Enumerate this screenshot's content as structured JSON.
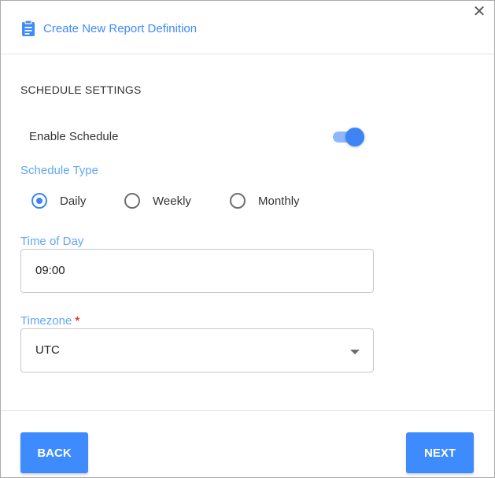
{
  "dialog": {
    "title": "Create New Report Definition",
    "header_icon": "clipboard-icon",
    "close_label": "✕"
  },
  "schedule": {
    "section_heading": "SCHEDULE SETTINGS",
    "enable_label": "Enable Schedule",
    "enabled": true,
    "type_label": "Schedule Type",
    "types": [
      {
        "label": "Daily",
        "checked": true
      },
      {
        "label": "Weekly",
        "checked": false
      },
      {
        "label": "Monthly",
        "checked": false
      }
    ],
    "time_label": "Time of Day",
    "time_value": "09:00",
    "timezone_label": "Timezone",
    "timezone_required_mark": "*",
    "timezone_value": "UTC"
  },
  "footer": {
    "back_label": "BACK",
    "next_label": "NEXT"
  },
  "colors": {
    "accent": "#3d8bfd",
    "label_blue": "#62a6f8",
    "required_red": "#e53935"
  }
}
